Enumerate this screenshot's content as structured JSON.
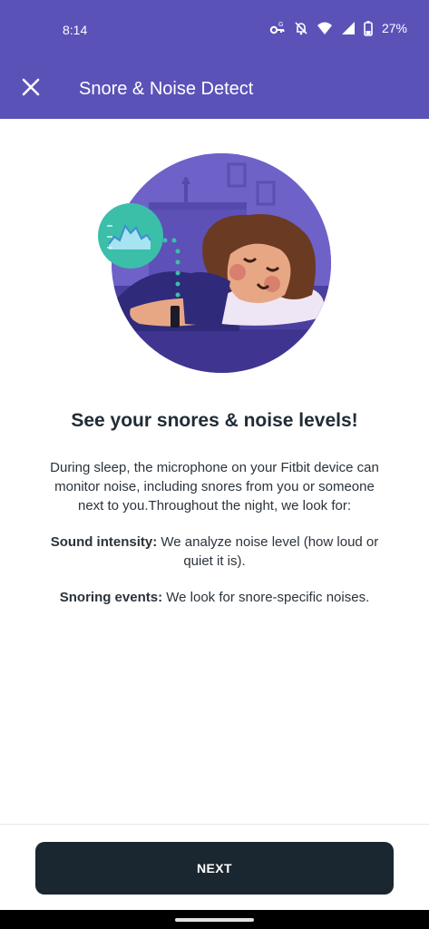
{
  "status_bar": {
    "time": "8:14",
    "battery_percent": "27%",
    "icons": [
      "vpn-key-icon",
      "notifications-off-icon",
      "wifi-icon",
      "signal-icon",
      "battery-icon"
    ]
  },
  "toolbar": {
    "close_icon": "close-icon",
    "title": "Snore & Noise Detect"
  },
  "content": {
    "heading": "See your snores & noise levels!",
    "intro": "During sleep, the microphone on your Fitbit device can monitor noise, including snores from you or someone next to you.Throughout the night, we look for:",
    "items": [
      {
        "label": "Sound intensity:",
        "text": " We analyze noise level (how loud or quiet it is)."
      },
      {
        "label": "Snoring events:",
        "text": " We look for snore-specific noises."
      }
    ]
  },
  "footer": {
    "next_label": "NEXT"
  },
  "colors": {
    "appbar": "#5b52b8",
    "button": "#1b2730",
    "heading": "#222c36"
  }
}
